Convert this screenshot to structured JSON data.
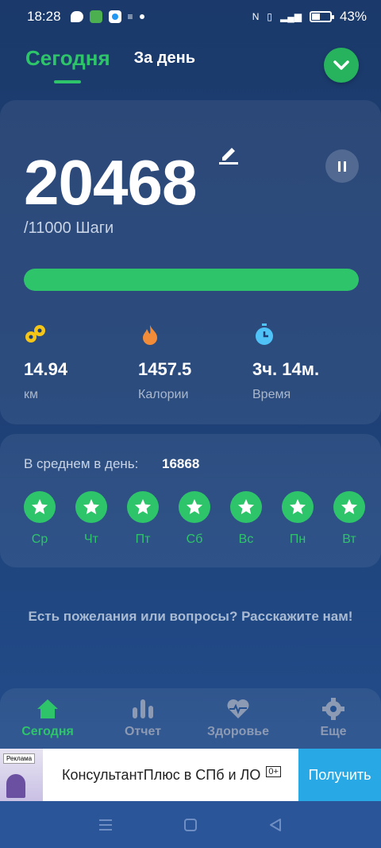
{
  "status_bar": {
    "time": "18:28",
    "battery_pct": "43%",
    "battery_level": 0.43
  },
  "header": {
    "tab_today": "Сегодня",
    "tab_day": "За день"
  },
  "steps": {
    "value": "20468",
    "goal": "/11000 Шаги",
    "progress_fraction": 1.0
  },
  "stats": [
    {
      "icon": "distance-icon",
      "value": "14.94",
      "label": "км",
      "color": "#f5c518"
    },
    {
      "icon": "flame-icon",
      "value": "1457.5",
      "label": "Калории",
      "color": "#f28c38"
    },
    {
      "icon": "timer-icon",
      "value": "3ч. 14м.",
      "label": "Время",
      "color": "#4fc3f7"
    }
  ],
  "average": {
    "label": "В среднем в день:",
    "value": "16868"
  },
  "week_days": [
    "Ср",
    "Чт",
    "Пт",
    "Сб",
    "Вс",
    "Пн",
    "Вт"
  ],
  "feedback": "Есть пожелания или вопросы? Расскажите нам!",
  "bottom_nav": [
    {
      "label": "Сегодня",
      "icon": "home-icon",
      "active": true
    },
    {
      "label": "Отчет",
      "icon": "bar-chart-icon",
      "active": false
    },
    {
      "label": "Здоровье",
      "icon": "heart-pulse-icon",
      "active": false
    },
    {
      "label": "Еще",
      "icon": "gear-icon",
      "active": false
    }
  ],
  "ad": {
    "badge": "Реклама",
    "text": "КонсультантПлюс в СПб и ЛО",
    "age": "0+",
    "cta": "Получить"
  },
  "colors": {
    "accent": "#2ec46a",
    "background": "#1d3f75",
    "ad_cta": "#28a9e6"
  }
}
